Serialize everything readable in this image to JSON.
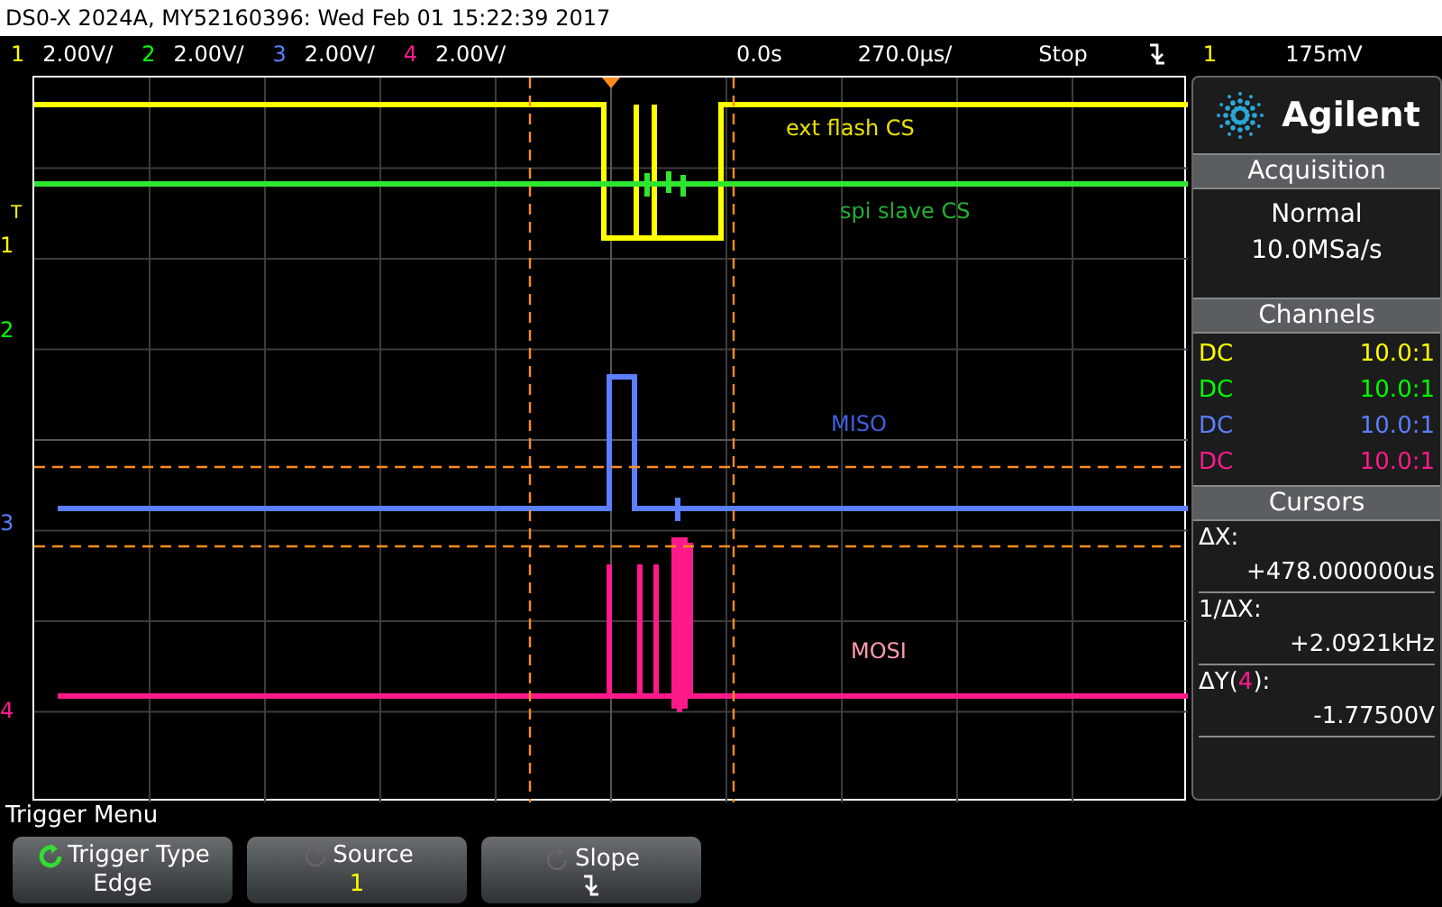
{
  "title_bar": "DS0-X 2024A, MY52160396: Wed Feb 01 15:22:39 2017",
  "status_bar": {
    "channels": [
      {
        "number": "1",
        "scale": "2.00V/",
        "color": "#ffff00"
      },
      {
        "number": "2",
        "scale": "2.00V/",
        "color": "#00ff00"
      },
      {
        "number": "3",
        "scale": "2.00V/",
        "color": "#5b7fff"
      },
      {
        "number": "4",
        "scale": "2.00V/",
        "color": "#ff1a8c"
      }
    ],
    "time_position": "0.0s",
    "time_scale": "270.0µs/",
    "run_state": "Stop",
    "trigger_source": "1",
    "trigger_level": "175mV"
  },
  "plot": {
    "trigger_marker": "T",
    "channel_markers": [
      {
        "number": "1",
        "color": "#ffff00"
      },
      {
        "number": "2",
        "color": "#00ff00"
      },
      {
        "number": "3",
        "color": "#5b7fff"
      },
      {
        "number": "4",
        "color": "#ff1a8c"
      }
    ],
    "trace_labels": [
      {
        "text": "ext flash CS",
        "color": "#e8e000"
      },
      {
        "text": "spi slave CS",
        "color": "#22b030"
      },
      {
        "text": "MISO",
        "color": "#4060e0"
      },
      {
        "text": "MOSI",
        "color": "#ff9ab0"
      }
    ]
  },
  "side_panel": {
    "brand": "Agilent",
    "acquisition": {
      "title": "Acquisition",
      "mode": "Normal",
      "rate": "10.0MSa/s"
    },
    "channels": {
      "title": "Channels",
      "rows": [
        {
          "coupling": "DC",
          "probe": "10.0:1",
          "color": "#ffff00"
        },
        {
          "coupling": "DC",
          "probe": "10.0:1",
          "color": "#00ff00"
        },
        {
          "coupling": "DC",
          "probe": "10.0:1",
          "color": "#5b7fff"
        },
        {
          "coupling": "DC",
          "probe": "10.0:1",
          "color": "#ff1a8c"
        }
      ]
    },
    "cursors": {
      "title": "Cursors",
      "rows": [
        {
          "label": "ΔX:",
          "value": "+478.000000us"
        },
        {
          "label": "1/ΔX:",
          "value": "+2.0921kHz"
        },
        {
          "label": "ΔY(",
          "channel": "4",
          "color": "#ff1a8c",
          "label_end": "):",
          "value": "-1.77500V"
        }
      ]
    }
  },
  "menu": {
    "title": "Trigger Menu",
    "softkeys": [
      {
        "title": "Trigger Type",
        "kind": "text",
        "value": "Edge",
        "active": true
      },
      {
        "title": "Source",
        "kind": "text",
        "value": "1",
        "active": false
      },
      {
        "title": "Slope",
        "kind": "slope",
        "active": false
      }
    ]
  }
}
